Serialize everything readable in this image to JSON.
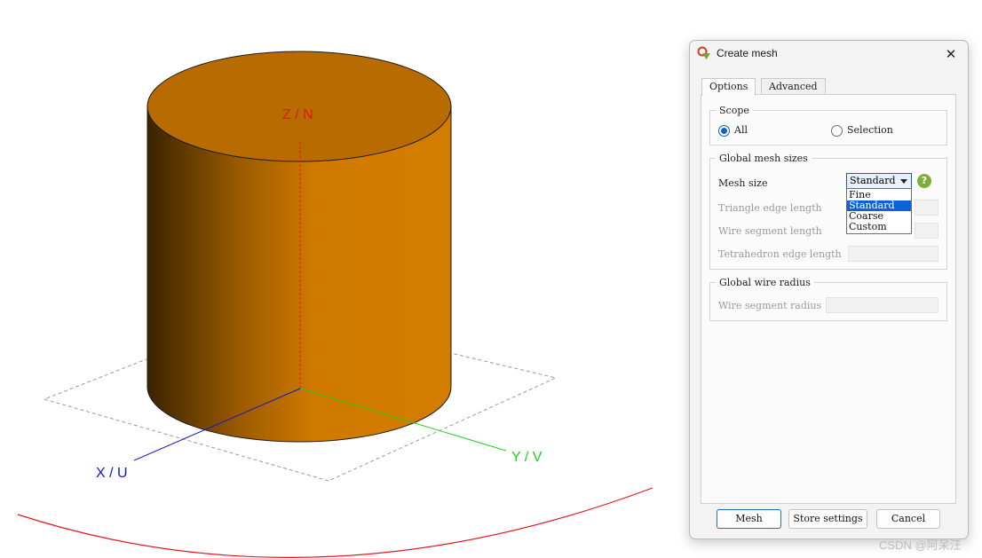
{
  "viewport": {
    "axis_z_label": "Z / N",
    "axis_y_label": "Y / V",
    "axis_x_label": "X / U",
    "cylinder_color": "#d07a00",
    "axis_colors": {
      "z": "#e0191e",
      "y": "#1fd21f",
      "x": "#1515c8"
    }
  },
  "dialog": {
    "title": "Create mesh",
    "close_glyph": "✕",
    "tabs": [
      {
        "label": "Options"
      },
      {
        "label": "Advanced"
      }
    ],
    "scope": {
      "legend": "Scope",
      "options": [
        {
          "label": "All",
          "checked": true
        },
        {
          "label": "Selection",
          "checked": false
        }
      ]
    },
    "global_mesh_sizes": {
      "legend": "Global mesh sizes",
      "mesh_size_label": "Mesh size",
      "mesh_size_value": "Standard",
      "help_glyph": "?",
      "dropdown_options": [
        "Fine",
        "Standard",
        "Coarse",
        "Custom"
      ],
      "selected_option": "Standard",
      "triangle_edge_label": "Triangle edge length",
      "wire_segment_label": "Wire segment length",
      "tetrahedron_edge_label": "Tetrahedron edge length"
    },
    "global_wire_radius": {
      "legend": "Global wire radius",
      "wire_segment_radius_label": "Wire segment radius"
    },
    "buttons": {
      "mesh": "Mesh",
      "store": "Store settings",
      "cancel": "Cancel"
    },
    "accent_color": "#0a64d6"
  },
  "watermark": "CSDN @阿呆汪"
}
